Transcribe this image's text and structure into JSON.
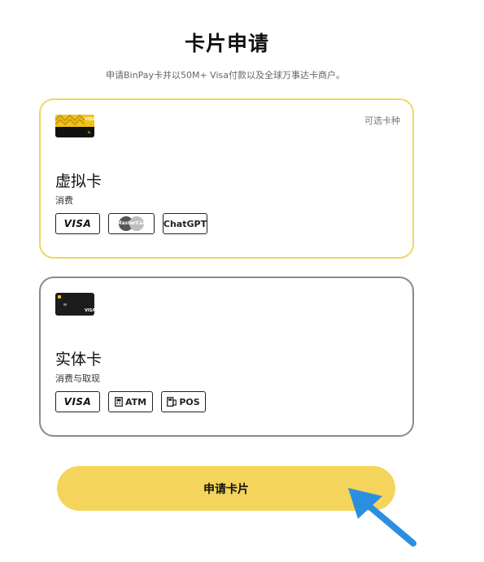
{
  "page": {
    "title": "卡片申请",
    "subtitle": "申请BinPay卡并以50M+ Visa付款以及全球万事达卡商户。"
  },
  "virtual_card": {
    "tag": "可选卡种",
    "title": "虚拟卡",
    "description": "消费",
    "badges": [
      "VISA",
      "MasterCard",
      "ChatGPT"
    ]
  },
  "physical_card": {
    "title": "实体卡",
    "description": "消费与取现",
    "badges": [
      "VISA",
      "ATM",
      "POS"
    ]
  },
  "apply_button": {
    "label": "申请卡片"
  },
  "colors": {
    "accent_yellow": "#f4d45a",
    "selected_border": "#f2d464",
    "unselected_border": "#8a8a8a",
    "arrow_blue": "#2a8fe0"
  }
}
